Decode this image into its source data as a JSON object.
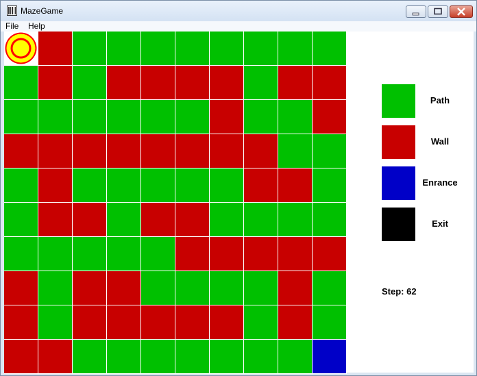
{
  "window": {
    "title": "MazeGame",
    "controls": [
      "minimize",
      "maximize",
      "close"
    ]
  },
  "menu": [
    {
      "label": "File"
    },
    {
      "label": "Help"
    }
  ],
  "colors": {
    "path": "#00c000",
    "wall": "#c80000",
    "entrance": "#0000c8",
    "exit": "#000000",
    "player_ring": "#ff0000",
    "player_fill": "#ffff00"
  },
  "maze": {
    "rows": [
      "PWPPPPPPPP",
      "PWPWWWWPWW",
      "PPPPPPWPPW",
      "WWWWWWWWPP",
      "PWPPPPPWWP",
      "PWWPWWPPPP",
      "PPPPPWWWWW",
      "WPWWPPPPWP",
      "WPWWWWWPWP",
      "WWPPPPPPPE"
    ],
    "player": {
      "row": 0,
      "col": 0
    }
  },
  "legend": [
    {
      "label": "Path",
      "color": "#00c000"
    },
    {
      "label": "Wall",
      "color": "#c80000"
    },
    {
      "label": "Enrance",
      "color": "#0000c8"
    },
    {
      "label": "Exit",
      "color": "#000000"
    }
  ],
  "status": {
    "step_text": "Step: 62"
  }
}
